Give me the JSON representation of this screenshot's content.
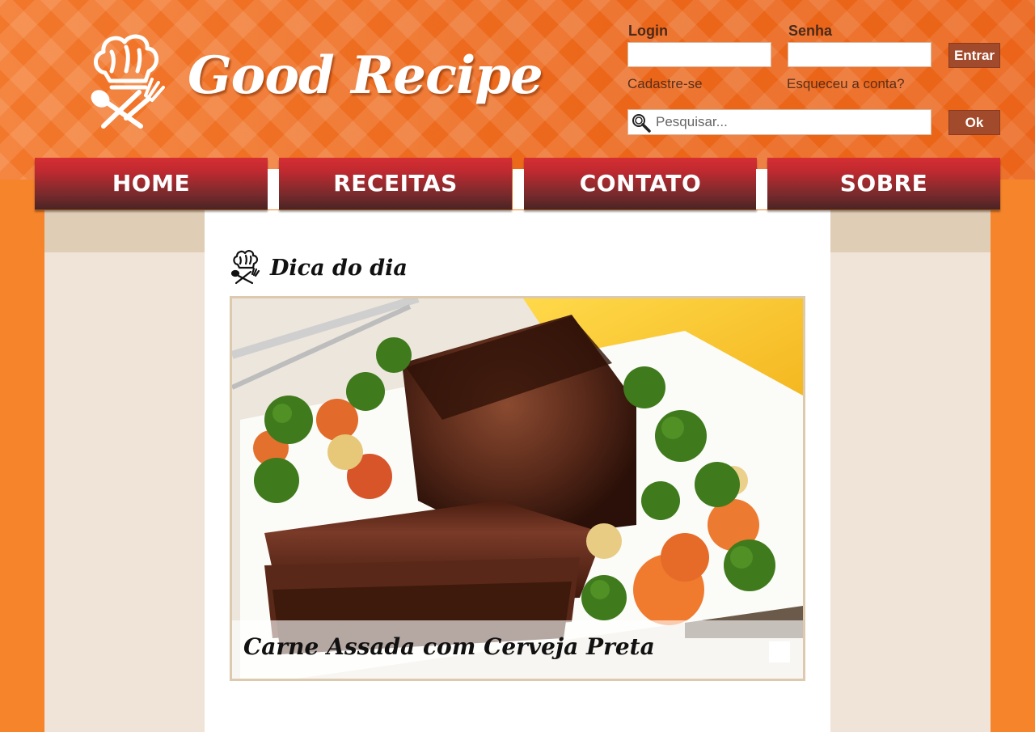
{
  "brand": {
    "name": "Good Recipe",
    "logo_icon": "chef-hat-spoon-fork-icon"
  },
  "login": {
    "login_label": "Login",
    "password_label": "Senha",
    "login_value": "",
    "password_value": "",
    "submit_label": "Entrar",
    "register_link": "Cadastre-se",
    "forgot_link": "Esqueceu a conta?"
  },
  "search": {
    "placeholder": "Pesquisar...",
    "icon": "magnifier-icon",
    "submit_label": "Ok"
  },
  "nav": {
    "items": [
      {
        "label": "HOME"
      },
      {
        "label": "RECEITAS"
      },
      {
        "label": "CONTATO"
      },
      {
        "label": "SOBRE"
      }
    ]
  },
  "main": {
    "section_title": "Dica do dia",
    "section_icon": "chef-hat-icon",
    "featured": {
      "title": "Carne Assada com Cerveja Preta",
      "image": "roast-beef-with-vegetables"
    }
  },
  "colors": {
    "header_orange": "#ee6a1c",
    "page_orange": "#f5842b",
    "nav_red": "#c02a30",
    "button_brown": "#a24a2c",
    "side_beige": "#efe4d7"
  }
}
